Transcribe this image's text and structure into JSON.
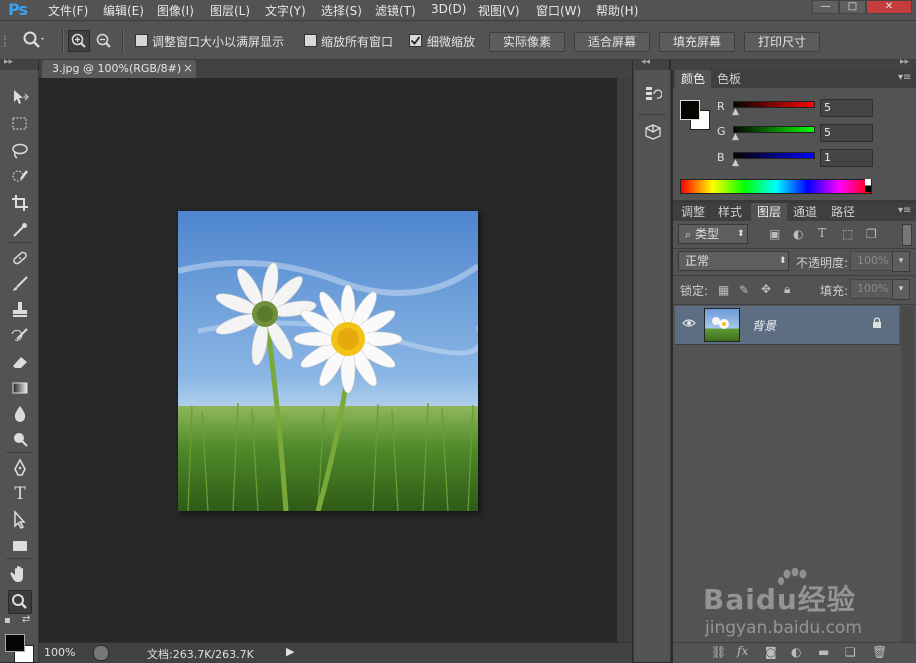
{
  "app": {
    "logo": "Ps"
  },
  "menu": [
    "文件(F)",
    "编辑(E)",
    "图像(I)",
    "图层(L)",
    "文字(Y)",
    "选择(S)",
    "滤镜(T)",
    "3D(D)",
    "视图(V)",
    "窗口(W)",
    "帮助(H)"
  ],
  "window_controls": {
    "minimize": "—",
    "restore": "□",
    "close": "✕"
  },
  "options": {
    "resize_windows_label": "调整窗口大小以满屏显示",
    "zoom_all_label": "缩放所有窗口",
    "scrubby_label": "细微缩放",
    "actual_pixels": "实际像素",
    "fit_screen": "适合屏幕",
    "fill_screen": "填充屏幕",
    "print_size": "打印尺寸",
    "resize_windows_checked": false,
    "zoom_all_checked": false,
    "scrubby_checked": true
  },
  "document": {
    "tab_title": "3.jpg @ 100%(RGB/8#)",
    "tab_close": "×",
    "zoom": "100%",
    "doc_info": "文档:263.7K/263.7K"
  },
  "color_panel": {
    "tabs": [
      "颜色",
      "色板"
    ],
    "r_label": "R",
    "g_label": "G",
    "b_label": "B",
    "r_value": "5",
    "g_value": "5",
    "b_value": "1",
    "foreground": "#050501",
    "background": "#ffffff"
  },
  "layers_panel": {
    "tabs": [
      "调整",
      "样式",
      "图层",
      "通道",
      "路径"
    ],
    "filter_label": "类型",
    "blend_mode": "正常",
    "opacity_label": "不透明度:",
    "opacity_value": "100%",
    "lock_label": "锁定:",
    "fill_label": "填充:",
    "fill_value": "100%",
    "layers": [
      {
        "name": "背景",
        "visible": true,
        "locked": true
      }
    ]
  },
  "watermark": {
    "brand": "Baidu经验",
    "url": "jingyan.baidu.com"
  },
  "colors": {
    "panel_bg": "#535353",
    "canvas_bg": "#282828",
    "selected_layer": "#5d6e83",
    "accent_blue": "#3ba0f0"
  }
}
